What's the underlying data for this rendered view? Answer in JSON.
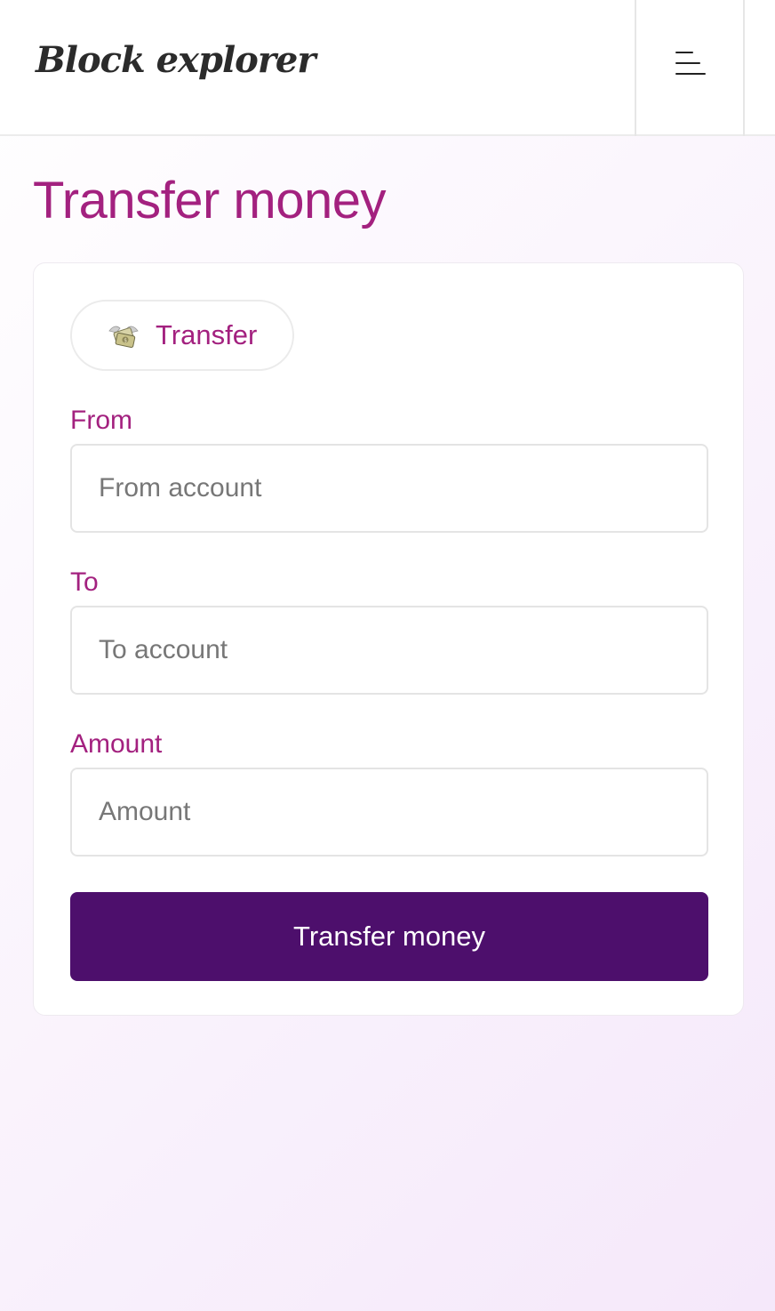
{
  "header": {
    "brand": "Block explorer",
    "menu_icon": "hamburger-menu-icon"
  },
  "page": {
    "title": "Transfer money"
  },
  "form": {
    "tab": {
      "label": "Transfer",
      "icon": "money-with-wings-icon"
    },
    "from": {
      "label": "From",
      "placeholder": "From account",
      "value": ""
    },
    "to": {
      "label": "To",
      "placeholder": "To account",
      "value": ""
    },
    "amount": {
      "label": "Amount",
      "placeholder": "Amount",
      "value": ""
    },
    "submit_label": "Transfer money"
  },
  "colors": {
    "accent": "#a3217f",
    "button": "#4d0f6c",
    "text_dark": "#2b2b2b"
  }
}
